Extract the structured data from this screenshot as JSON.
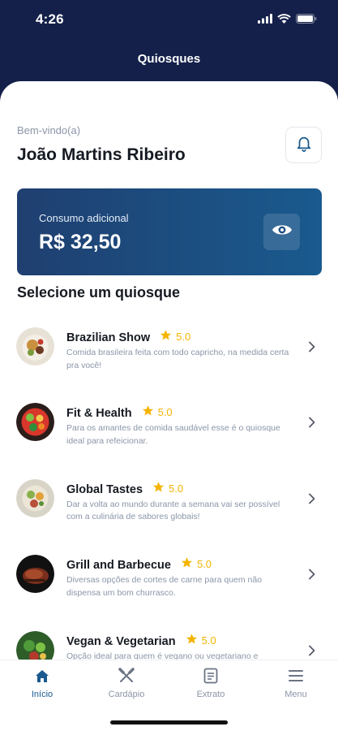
{
  "status_bar": {
    "time": "4:26"
  },
  "header": {
    "title": "Quiosques"
  },
  "welcome": {
    "greeting": "Bem-vindo(a)",
    "user_name": "João Martins Ribeiro"
  },
  "balance": {
    "label": "Consumo adicional",
    "value": "R$ 32,50"
  },
  "section_title": "Selecione um quiosque",
  "kiosks": [
    {
      "name": "Brazilian Show",
      "rating": "5.0",
      "description": "Comida brasileira feita com todo capricho, na medida certa pra você!"
    },
    {
      "name": "Fit & Health",
      "rating": "5.0",
      "description": "Para os amantes de comida saudável esse é o quiosque ideal para refeicionar."
    },
    {
      "name": "Global Tastes",
      "rating": "5.0",
      "description": "Dar a volta ao mundo durante a semana vai ser possível com a culinária de sabores globais!"
    },
    {
      "name": "Grill and Barbecue",
      "rating": "5.0",
      "description": "Diversas opções de cortes de carne para quem não dispensa um bom churrasco."
    },
    {
      "name": "Vegan & Vegetarian",
      "rating": "5.0",
      "description": "Opção ideal para quem é vegano ou vegetariano e"
    }
  ],
  "tabs": [
    {
      "label": "Início",
      "icon": "home-icon",
      "active": true
    },
    {
      "label": "Cardápio",
      "icon": "fork-knife-icon",
      "active": false
    },
    {
      "label": "Extrato",
      "icon": "receipt-icon",
      "active": false
    },
    {
      "label": "Menu",
      "icon": "hamburger-menu-icon",
      "active": false
    }
  ],
  "colors": {
    "navy": "#14204a",
    "card_start": "#1f3f70",
    "card_end": "#1a5a8e",
    "star": "#f4b400",
    "muted_text": "#8b96a8"
  }
}
